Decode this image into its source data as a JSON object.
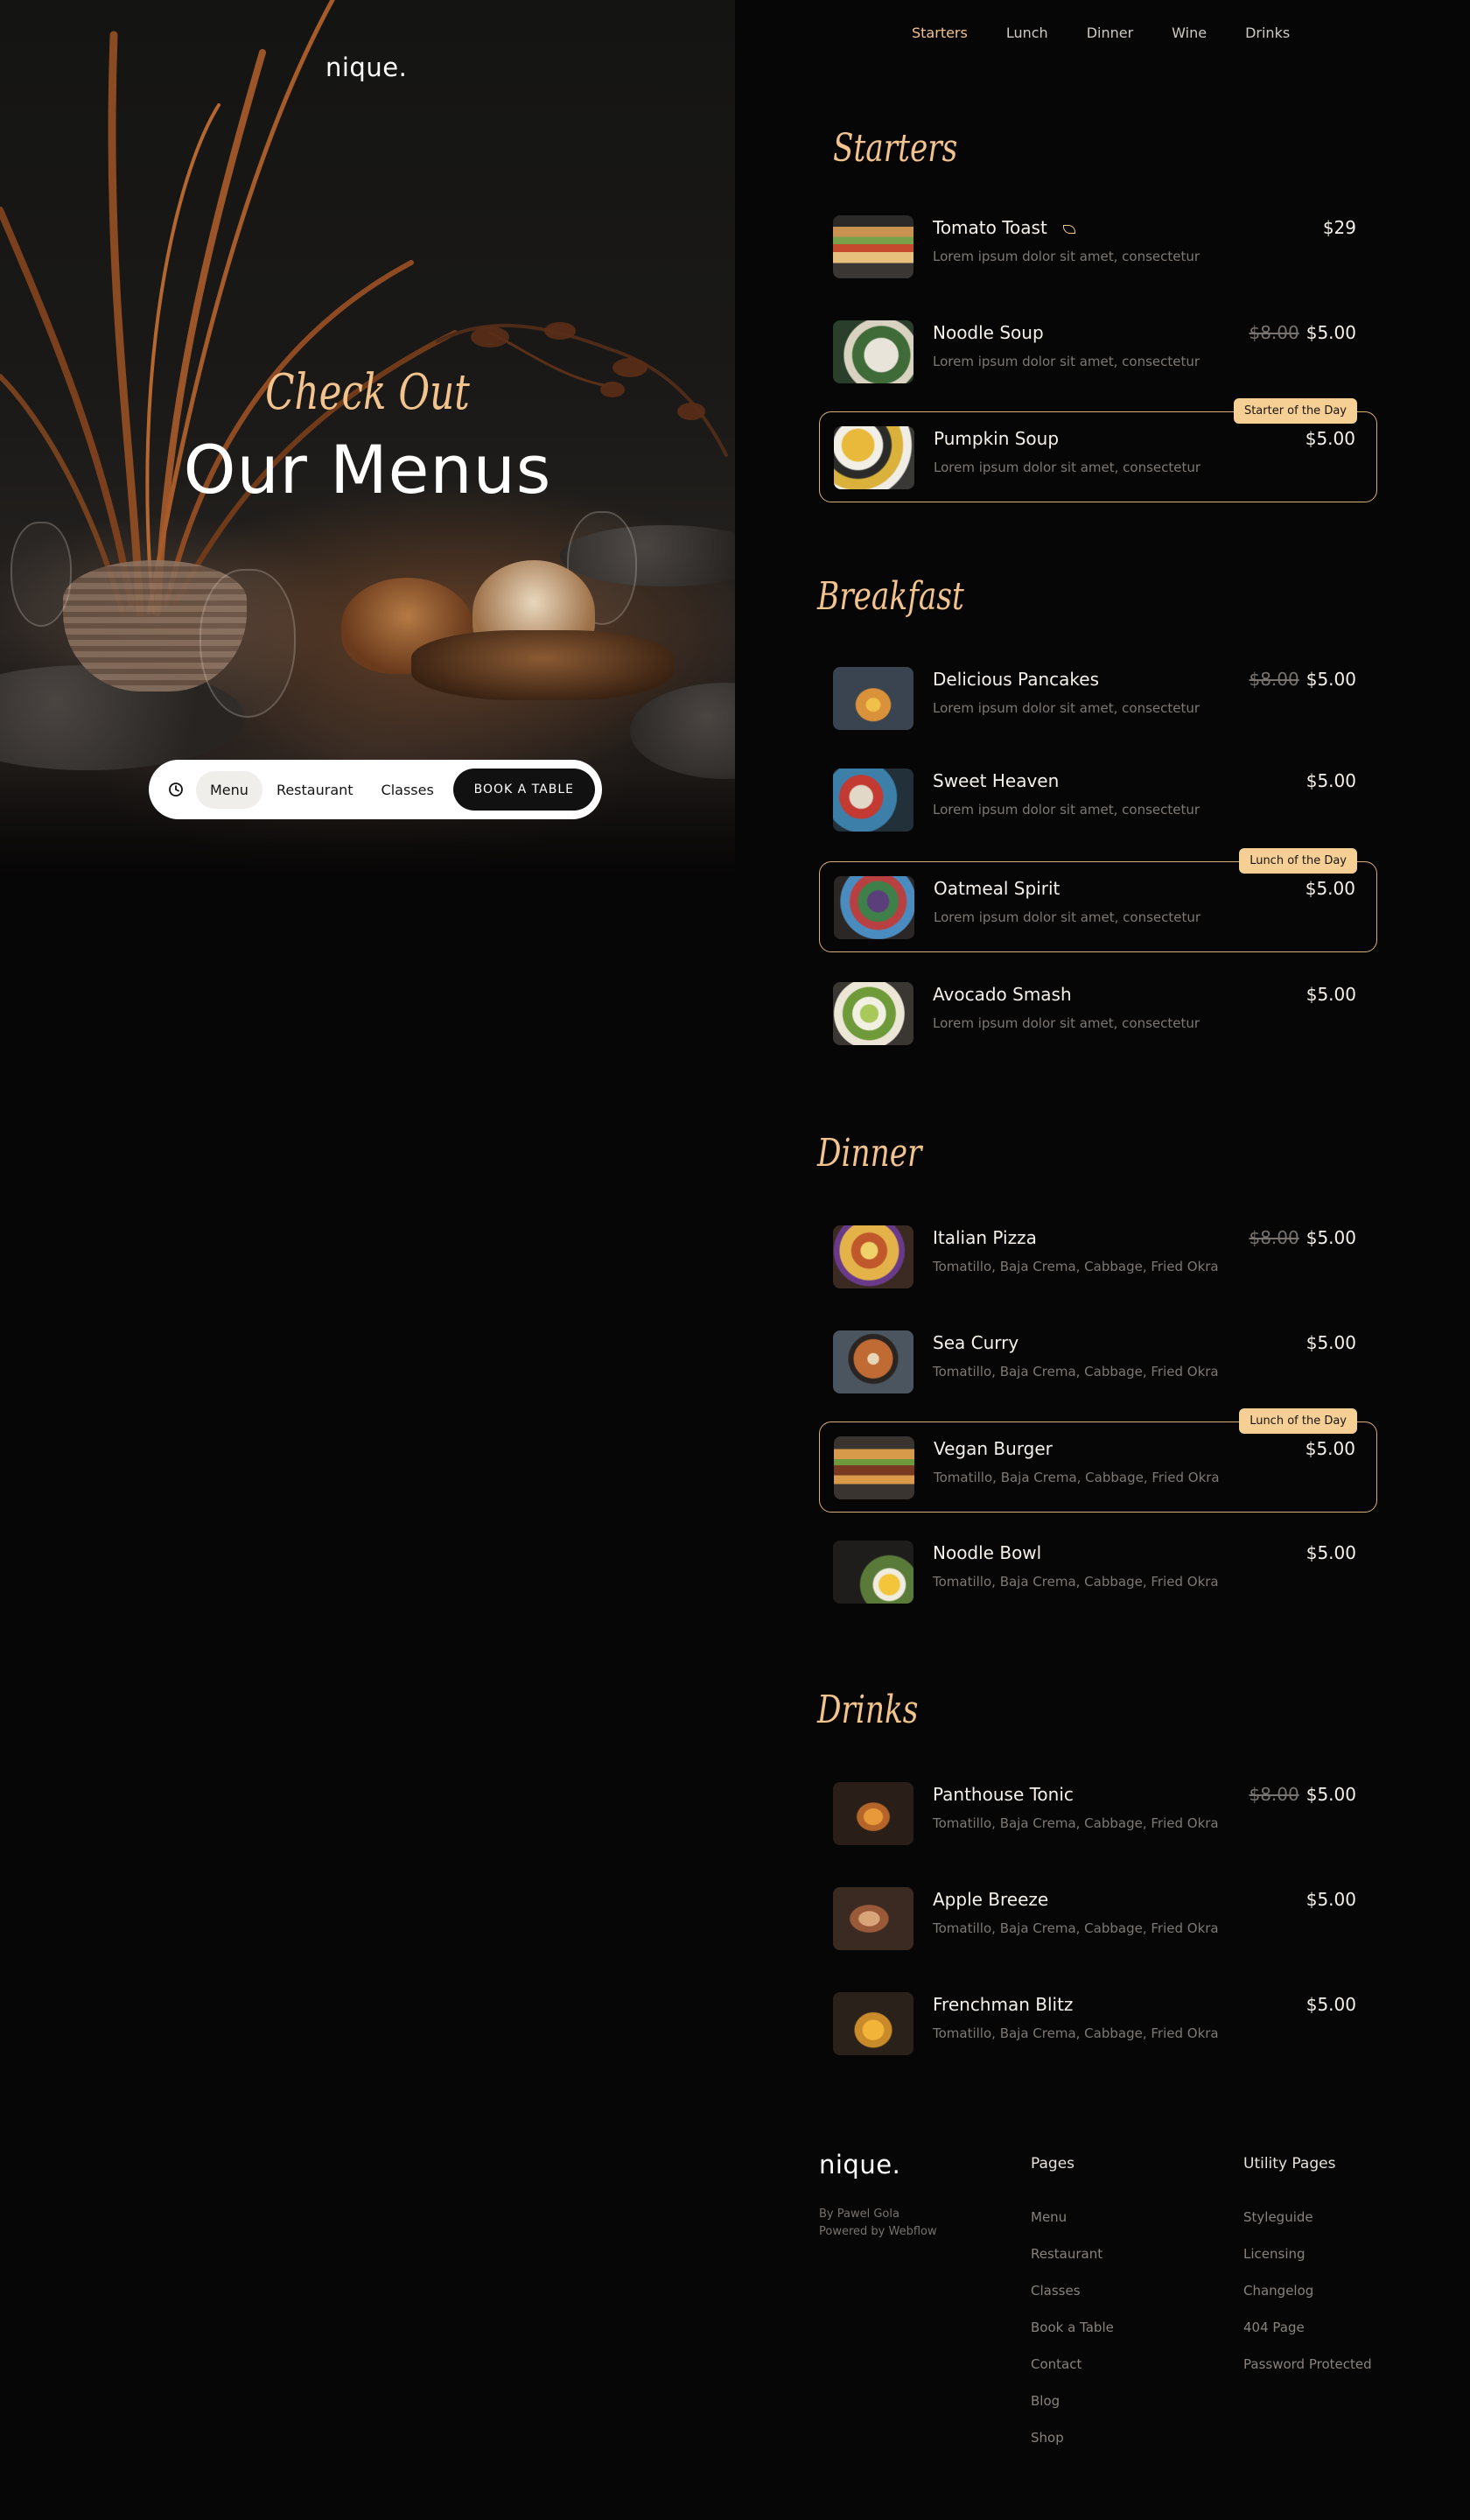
{
  "hero": {
    "logo": "nique.",
    "kicker": "Check Out",
    "title": "Our Menus",
    "nav": {
      "clock_icon": "clock-icon",
      "items": [
        "Menu",
        "Restaurant",
        "Classes"
      ],
      "active": "Menu",
      "cta": "BOOK A TABLE"
    }
  },
  "top_tabs": {
    "items": [
      "Starters",
      "Lunch",
      "Dinner",
      "Wine",
      "Drinks"
    ],
    "active": "Starters"
  },
  "sections": {
    "starters": {
      "title": "Starters",
      "items": [
        {
          "name": "Tomato Toast",
          "desc": "Lorem ipsum dolor sit amet, consectetur",
          "price": "$29",
          "icon": "leaf-icon"
        },
        {
          "name": "Noodle Soup",
          "desc": "Lorem ipsum dolor sit amet, consectetur",
          "old_price": "$8.00",
          "price": "$5.00"
        },
        {
          "name": "Pumpkin Soup",
          "desc": "Lorem ipsum dolor sit amet, consectetur",
          "price": "$5.00",
          "badge": "Starter of the Day"
        }
      ]
    },
    "breakfast": {
      "title": "Breakfast",
      "items": [
        {
          "name": "Delicious Pancakes",
          "desc": "Lorem ipsum dolor sit amet, consectetur",
          "old_price": "$8.00",
          "price": "$5.00"
        },
        {
          "name": "Sweet Heaven",
          "desc": "Lorem ipsum dolor sit amet, consectetur",
          "price": "$5.00"
        },
        {
          "name": "Oatmeal Spirit",
          "desc": "Lorem ipsum dolor sit amet, consectetur",
          "price": "$5.00",
          "badge": "Lunch of the Day"
        },
        {
          "name": "Avocado Smash",
          "desc": "Lorem ipsum dolor sit amet, consectetur",
          "price": "$5.00"
        }
      ]
    },
    "dinner": {
      "title": "Dinner",
      "items": [
        {
          "name": "Italian Pizza",
          "desc": "Tomatillo, Baja Crema, Cabbage, Fried Okra",
          "old_price": "$8.00",
          "price": "$5.00"
        },
        {
          "name": "Sea Curry",
          "desc": "Tomatillo, Baja Crema, Cabbage, Fried Okra",
          "price": "$5.00"
        },
        {
          "name": "Vegan Burger",
          "desc": "Tomatillo, Baja Crema, Cabbage, Fried Okra",
          "price": "$5.00",
          "badge": "Lunch of the Day"
        },
        {
          "name": "Noodle Bowl",
          "desc": "Tomatillo, Baja Crema, Cabbage, Fried Okra",
          "price": "$5.00"
        }
      ]
    },
    "drinks": {
      "title": "Drinks",
      "items": [
        {
          "name": "Panthouse Tonic",
          "desc": "Tomatillo, Baja Crema, Cabbage, Fried Okra",
          "old_price": "$8.00",
          "price": "$5.00"
        },
        {
          "name": "Apple Breeze",
          "desc": "Tomatillo, Baja Crema, Cabbage, Fried Okra",
          "price": "$5.00"
        },
        {
          "name": "Frenchman Blitz",
          "desc": "Tomatillo, Baja Crema, Cabbage, Fried Okra",
          "price": "$5.00"
        }
      ]
    }
  },
  "footer": {
    "logo": "nique.",
    "credits": [
      "By Pawel Gola",
      "Powered by Webflow"
    ],
    "pages": {
      "title": "Pages",
      "links": [
        "Menu",
        "Restaurant",
        "Classes",
        "Book a Table",
        "Contact",
        "Blog",
        "Shop"
      ]
    },
    "utility": {
      "title": "Utility Pages",
      "links": [
        "Styleguide",
        "Licensing",
        "Changelog",
        "404 Page",
        "Password Protected"
      ]
    }
  },
  "colors": {
    "background": "#070606",
    "accent": "#f2c38d",
    "badge": "#f6cf95",
    "featured_border": "#d9b07a",
    "muted_text": "#7d7873"
  }
}
